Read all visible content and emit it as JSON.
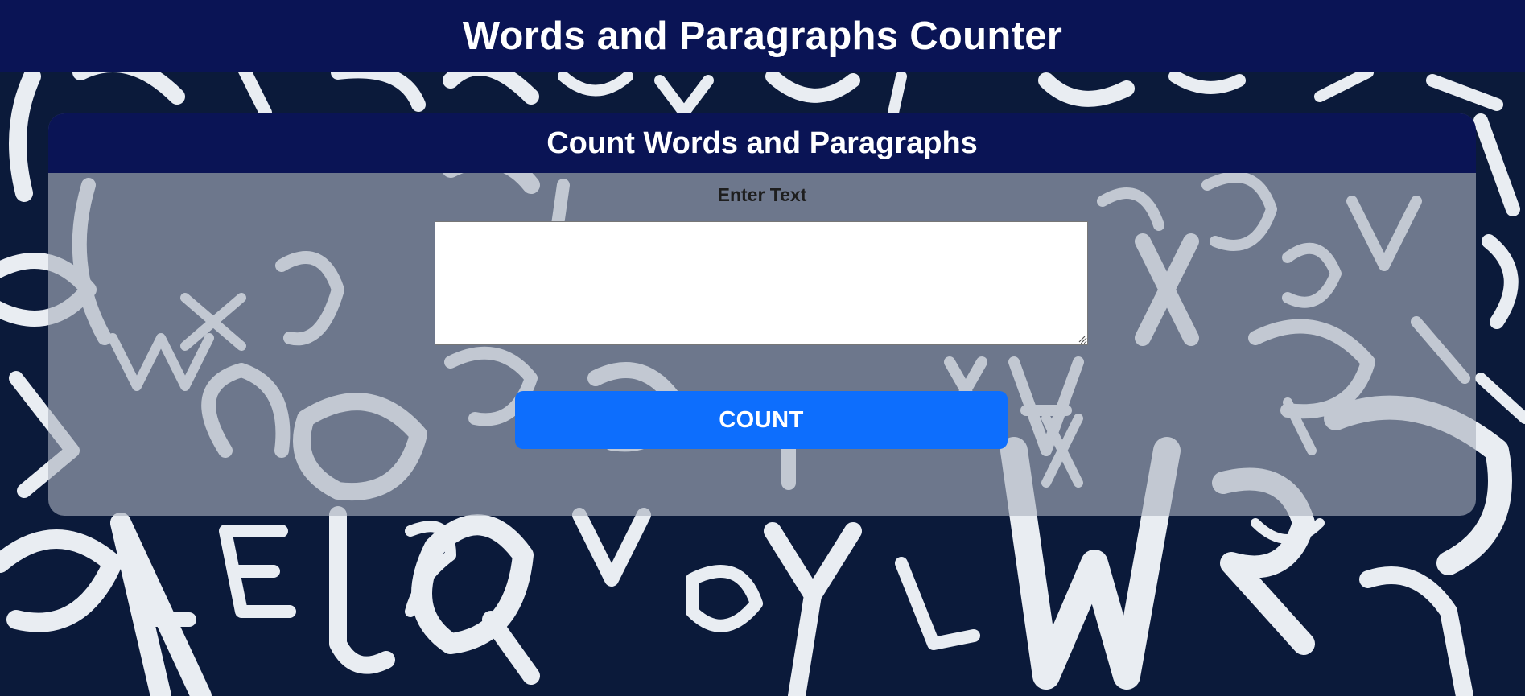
{
  "page": {
    "title": "Words and Paragraphs Counter"
  },
  "card": {
    "title": "Count Words and Paragraphs",
    "label": "Enter Text",
    "textarea_value": "",
    "button_label": "COUNT"
  },
  "colors": {
    "header_bg": "#0a1455",
    "background": "#0b1a3a",
    "button": "#0d6efd",
    "letters": "#e9edf2"
  },
  "background_pattern": "scattered-handwritten-letters"
}
